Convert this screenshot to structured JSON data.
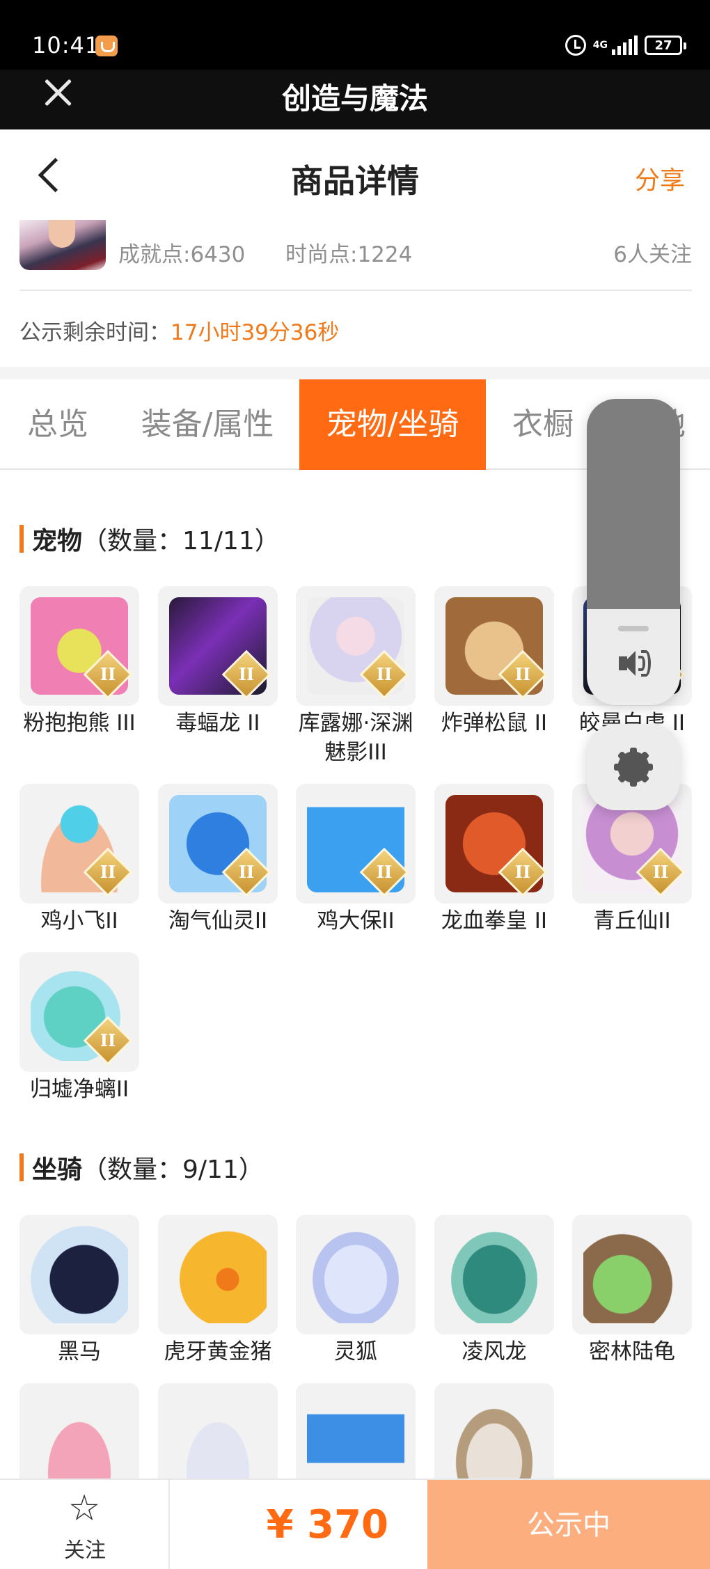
{
  "status_bar": {
    "time": "10:41",
    "network": "4G",
    "battery": "27"
  },
  "app_bar": {
    "title": "创造与魔法"
  },
  "page_header": {
    "title": "商品详情",
    "share": "分享"
  },
  "account": {
    "achievement": "成就点:6430",
    "fashion": "时尚点:1224",
    "followers": "6人关注"
  },
  "countdown": {
    "label": "公示剩余时间：",
    "value": "17小时39分36秒"
  },
  "tabs": [
    "总览",
    "装备/属性",
    "宠物/坐骑",
    "衣橱",
    "其他"
  ],
  "active_tab": 2,
  "pets": {
    "title": "宠物",
    "count": "（数量：11/11）",
    "items": [
      {
        "name": "粉抱抱熊 III"
      },
      {
        "name": "毒蝠龙 II"
      },
      {
        "name": "库露娜·深渊魅影III"
      },
      {
        "name": "炸弹松鼠 II"
      },
      {
        "name": "皎曼白虎 II"
      },
      {
        "name": "鸡小飞II"
      },
      {
        "name": "淘气仙灵II"
      },
      {
        "name": "鸡大保II"
      },
      {
        "name": "龙血拳皇 II"
      },
      {
        "name": "青丘仙II"
      },
      {
        "name": "归墟净螭II"
      }
    ]
  },
  "mounts": {
    "title": "坐骑",
    "count": "（数量：9/11）",
    "items": [
      {
        "name": "黑马"
      },
      {
        "name": "虎牙黄金猪"
      },
      {
        "name": "灵狐"
      },
      {
        "name": "凌风龙"
      },
      {
        "name": "密林陆龟"
      },
      {
        "name": ""
      },
      {
        "name": ""
      },
      {
        "name": ""
      },
      {
        "name": ""
      }
    ]
  },
  "bottom_bar": {
    "follow_label": "关注",
    "price": "¥ 370",
    "status": "公示中"
  },
  "colors": {
    "accent": "#ff6a13",
    "accent_text": "#f07a1a",
    "status_btn": "#fcae7f"
  }
}
